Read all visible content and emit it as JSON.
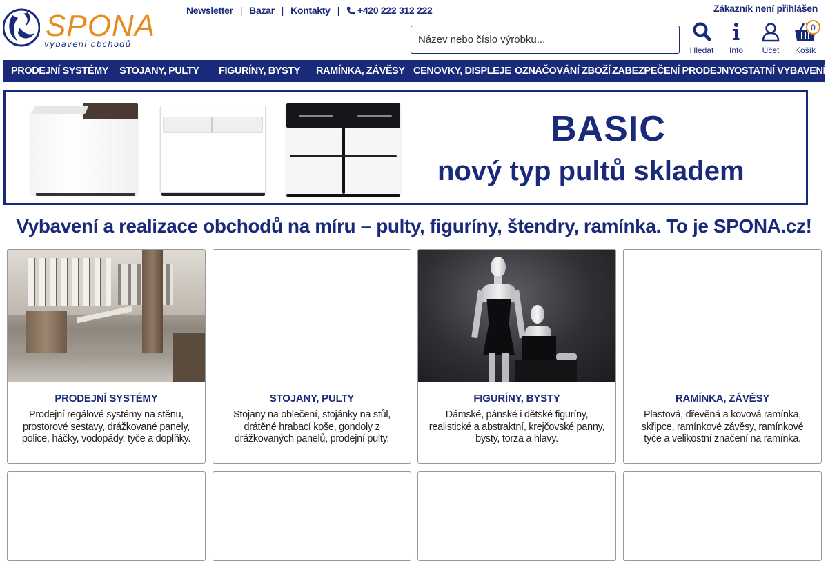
{
  "brand": {
    "name": "SPONA",
    "tagline": "vybavení obchodů"
  },
  "toplinks": {
    "newsletter": "Newsletter",
    "bazar": "Bazar",
    "kontakty": "Kontakty",
    "separator": "|",
    "phone": "+420 222 312 222"
  },
  "customer_status": "Zákazník není přihlášen",
  "search": {
    "placeholder": "Název nebo číslo výrobku..."
  },
  "icons": {
    "search": {
      "label": "Hledat",
      "icon": "search-icon"
    },
    "info": {
      "label": "Info",
      "icon": "info-icon"
    },
    "account": {
      "label": "Účet",
      "icon": "user-icon"
    },
    "cart": {
      "label": "Košík",
      "icon": "basket-icon",
      "count": "0"
    }
  },
  "nav": [
    {
      "label": "Prodejní systémy"
    },
    {
      "label": "Stojany, pulty"
    },
    {
      "label": "Figuríny, bysty"
    },
    {
      "label": "Ramínka, závěsy"
    },
    {
      "label": "Cenovky, displeje"
    },
    {
      "label": "Označování zboží"
    },
    {
      "label": "Zabezpečení prodejny"
    },
    {
      "label": "Ostatní vybavení"
    }
  ],
  "banner": {
    "title": "BASIC",
    "subtitle": "nový typ pultů skladem"
  },
  "headline": "Vybavení a realizace obchodů na míru – pulty, figuríny, štendry, ramínka. To je SPONA.cz!",
  "cards": [
    {
      "title": "Prodejní systémy",
      "desc": "Prodejní regálové systémy na stěnu, prostorové sestavy, drážkované panely, police, háčky, vodopády, tyče a doplňky."
    },
    {
      "title": "Stojany, pulty",
      "desc": "Stojany na oblečení, stojánky na stůl, drátěné hrabací koše, gondoly z drážkovaných panelů, prodejní pulty."
    },
    {
      "title": "Figuríny, bysty",
      "desc": "Dámské, pánské i dětské figuríny, realistické a abstraktní, krejčovské panny, bysty, torza a hlavy."
    },
    {
      "title": "Ramínka, závěsy",
      "desc": "Plastová, dřevěná a kovová ramínka, skřipce, ramínkové závěsy, ramínkové tyče a velikostní značení na ramínka."
    }
  ],
  "colors": {
    "brand_blue": "#1a2a7a",
    "brand_orange": "#e88b1e"
  }
}
